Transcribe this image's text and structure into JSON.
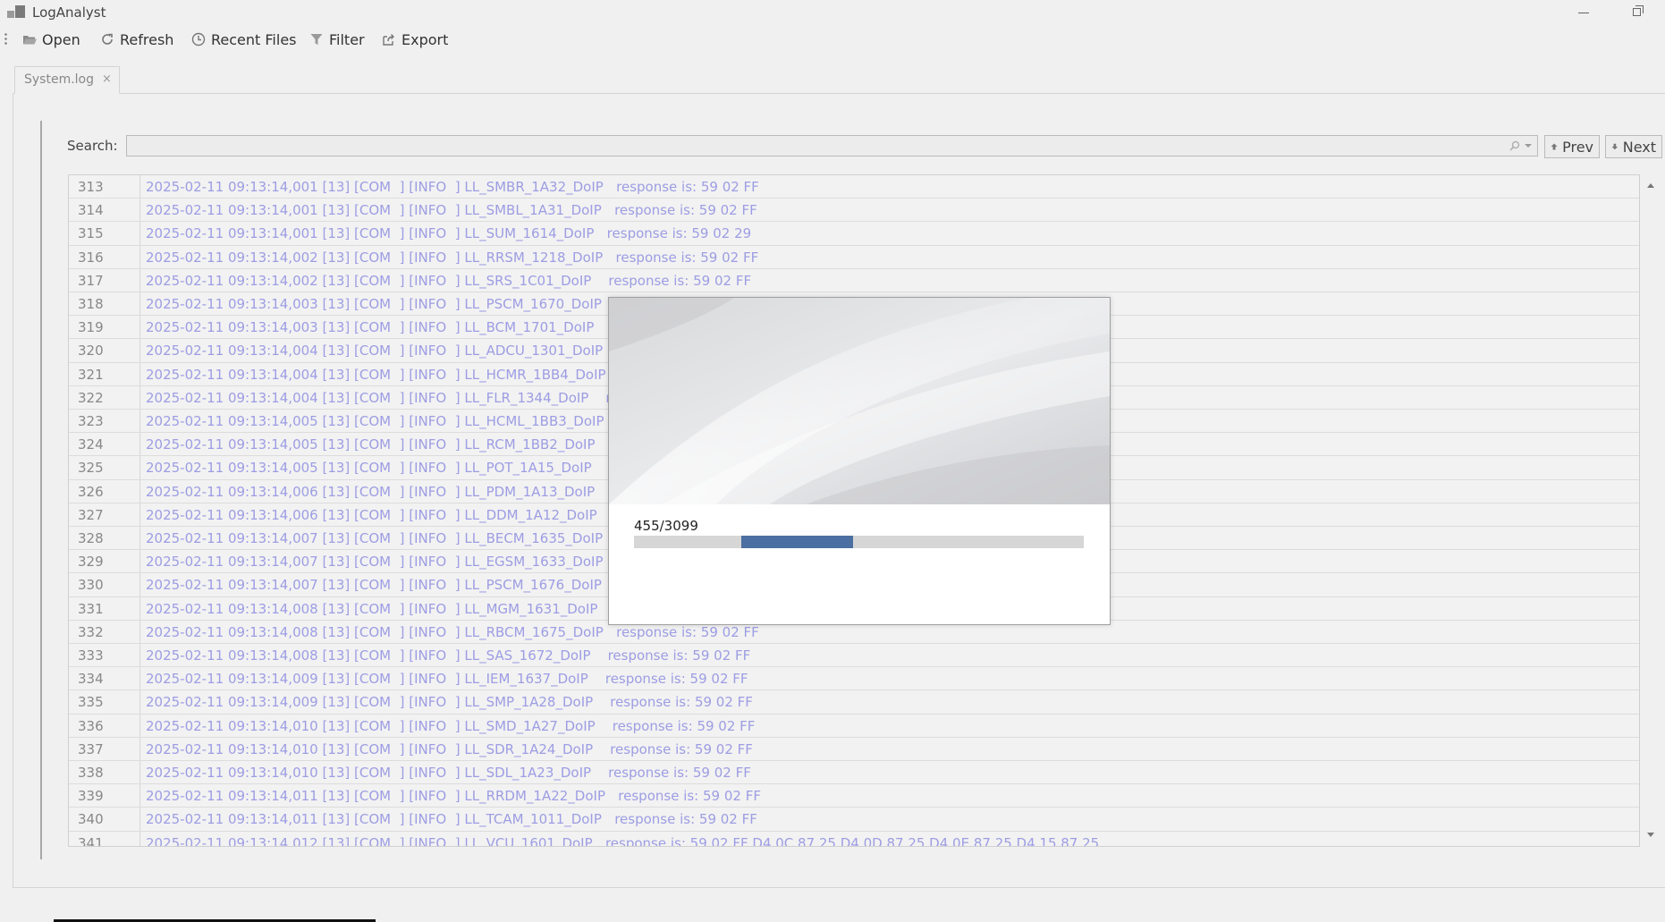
{
  "app": {
    "title": "LogAnalyst"
  },
  "toolbar": {
    "open": "Open",
    "refresh": "Refresh",
    "recent_files": "Recent Files",
    "filter": "Filter",
    "export": "Export"
  },
  "tabs": [
    {
      "label": "System.log",
      "close": "×"
    }
  ],
  "search": {
    "label": "Search:",
    "value": "",
    "prev_label": "Prev",
    "next_label": "Next"
  },
  "log": {
    "rows": [
      {
        "line": "313",
        "text": "2025-02-11 09:13:14,001 [13] [COM  ] [INFO  ] LL_SMBR_1A32_DoIP   response is: 59 02 FF"
      },
      {
        "line": "314",
        "text": "2025-02-11 09:13:14,001 [13] [COM  ] [INFO  ] LL_SMBL_1A31_DoIP   response is: 59 02 FF"
      },
      {
        "line": "315",
        "text": "2025-02-11 09:13:14,001 [13] [COM  ] [INFO  ] LL_SUM_1614_DoIP   response is: 59 02 29"
      },
      {
        "line": "316",
        "text": "2025-02-11 09:13:14,002 [13] [COM  ] [INFO  ] LL_RRSM_1218_DoIP   response is: 59 02 FF"
      },
      {
        "line": "317",
        "text": "2025-02-11 09:13:14,002 [13] [COM  ] [INFO  ] LL_SRS_1C01_DoIP    response is: 59 02 FF"
      },
      {
        "line": "318",
        "text": "2025-02-11 09:13:14,003 [13] [COM  ] [INFO  ] LL_PSCM_1670_DoIP   res"
      },
      {
        "line": "319",
        "text": "2025-02-11 09:13:14,003 [13] [COM  ] [INFO  ] LL_BCM_1701_DoIP    res"
      },
      {
        "line": "320",
        "text": "2025-02-11 09:13:14,004 [13] [COM  ] [INFO  ] LL_ADCU_1301_DoIP   re"
      },
      {
        "line": "321",
        "text": "2025-02-11 09:13:14,004 [13] [COM  ] [INFO  ] LL_HCMR_1BB4_DoIP   re"
      },
      {
        "line": "322",
        "text": "2025-02-11 09:13:14,004 [13] [COM  ] [INFO  ] LL_FLR_1344_DoIP    resp"
      },
      {
        "line": "323",
        "text": "2025-02-11 09:13:14,005 [13] [COM  ] [INFO  ] LL_HCML_1BB3_DoIP   re"
      },
      {
        "line": "324",
        "text": "2025-02-11 09:13:14,005 [13] [COM  ] [INFO  ] LL_RCM_1BB2_DoIP    res"
      },
      {
        "line": "325",
        "text": "2025-02-11 09:13:14,005 [13] [COM  ] [INFO  ] LL_POT_1A15_DoIP    res"
      },
      {
        "line": "326",
        "text": "2025-02-11 09:13:14,006 [13] [COM  ] [INFO  ] LL_PDM_1A13_DoIP    res"
      },
      {
        "line": "327",
        "text": "2025-02-11 09:13:14,006 [13] [COM  ] [INFO  ] LL_DDM_1A12_DoIP    res"
      },
      {
        "line": "328",
        "text": "2025-02-11 09:13:14,007 [13] [COM  ] [INFO  ] LL_BECM_1635_DoIP   res"
      },
      {
        "line": "329",
        "text": "2025-02-11 09:13:14,007 [13] [COM  ] [INFO  ] LL_EGSM_1633_DoIP   re"
      },
      {
        "line": "330",
        "text": "2025-02-11 09:13:14,007 [13] [COM  ] [INFO  ] LL_PSCM_1676_DoIP   re"
      },
      {
        "line": "331",
        "text": "2025-02-11 09:13:14,008 [13] [COM  ] [INFO  ] LL_MGM_1631_DoIP    re"
      },
      {
        "line": "332",
        "text": "2025-02-11 09:13:14,008 [13] [COM  ] [INFO  ] LL_RBCM_1675_DoIP   response is: 59 02 FF"
      },
      {
        "line": "333",
        "text": "2025-02-11 09:13:14,008 [13] [COM  ] [INFO  ] LL_SAS_1672_DoIP    response is: 59 02 FF"
      },
      {
        "line": "334",
        "text": "2025-02-11 09:13:14,009 [13] [COM  ] [INFO  ] LL_IEM_1637_DoIP    response is: 59 02 FF"
      },
      {
        "line": "335",
        "text": "2025-02-11 09:13:14,009 [13] [COM  ] [INFO  ] LL_SMP_1A28_DoIP    response is: 59 02 FF"
      },
      {
        "line": "336",
        "text": "2025-02-11 09:13:14,010 [13] [COM  ] [INFO  ] LL_SMD_1A27_DoIP    response is: 59 02 FF"
      },
      {
        "line": "337",
        "text": "2025-02-11 09:13:14,010 [13] [COM  ] [INFO  ] LL_SDR_1A24_DoIP    response is: 59 02 FF"
      },
      {
        "line": "338",
        "text": "2025-02-11 09:13:14,010 [13] [COM  ] [INFO  ] LL_SDL_1A23_DoIP    response is: 59 02 FF"
      },
      {
        "line": "339",
        "text": "2025-02-11 09:13:14,011 [13] [COM  ] [INFO  ] LL_RRDM_1A22_DoIP   response is: 59 02 FF"
      },
      {
        "line": "340",
        "text": "2025-02-11 09:13:14,011 [13] [COM  ] [INFO  ] LL_TCAM_1011_DoIP   response is: 59 02 FF"
      },
      {
        "line": "341",
        "text": "2025-02-11 09:13:14,012 [13] [COM  ] [INFO  ] LL_VCU_1601_DoIP   response is: 59 02 FF D4 0C 87 25 D4 0D 87 25 D4 0E 87 25 D4 15 87 25"
      }
    ]
  },
  "progress": {
    "text": "455/3099",
    "start_fraction": 0.238,
    "fill_fraction": 0.248
  },
  "colors": {
    "log_text": "#9d9de4",
    "progress_fill": "#4a6fa0"
  },
  "icons": {
    "open": "folder-open-icon",
    "refresh": "refresh-icon",
    "recent": "clock-icon",
    "filter": "funnel-icon",
    "export": "export-icon",
    "prev": "arrow-up-icon",
    "next": "arrow-down-icon"
  }
}
